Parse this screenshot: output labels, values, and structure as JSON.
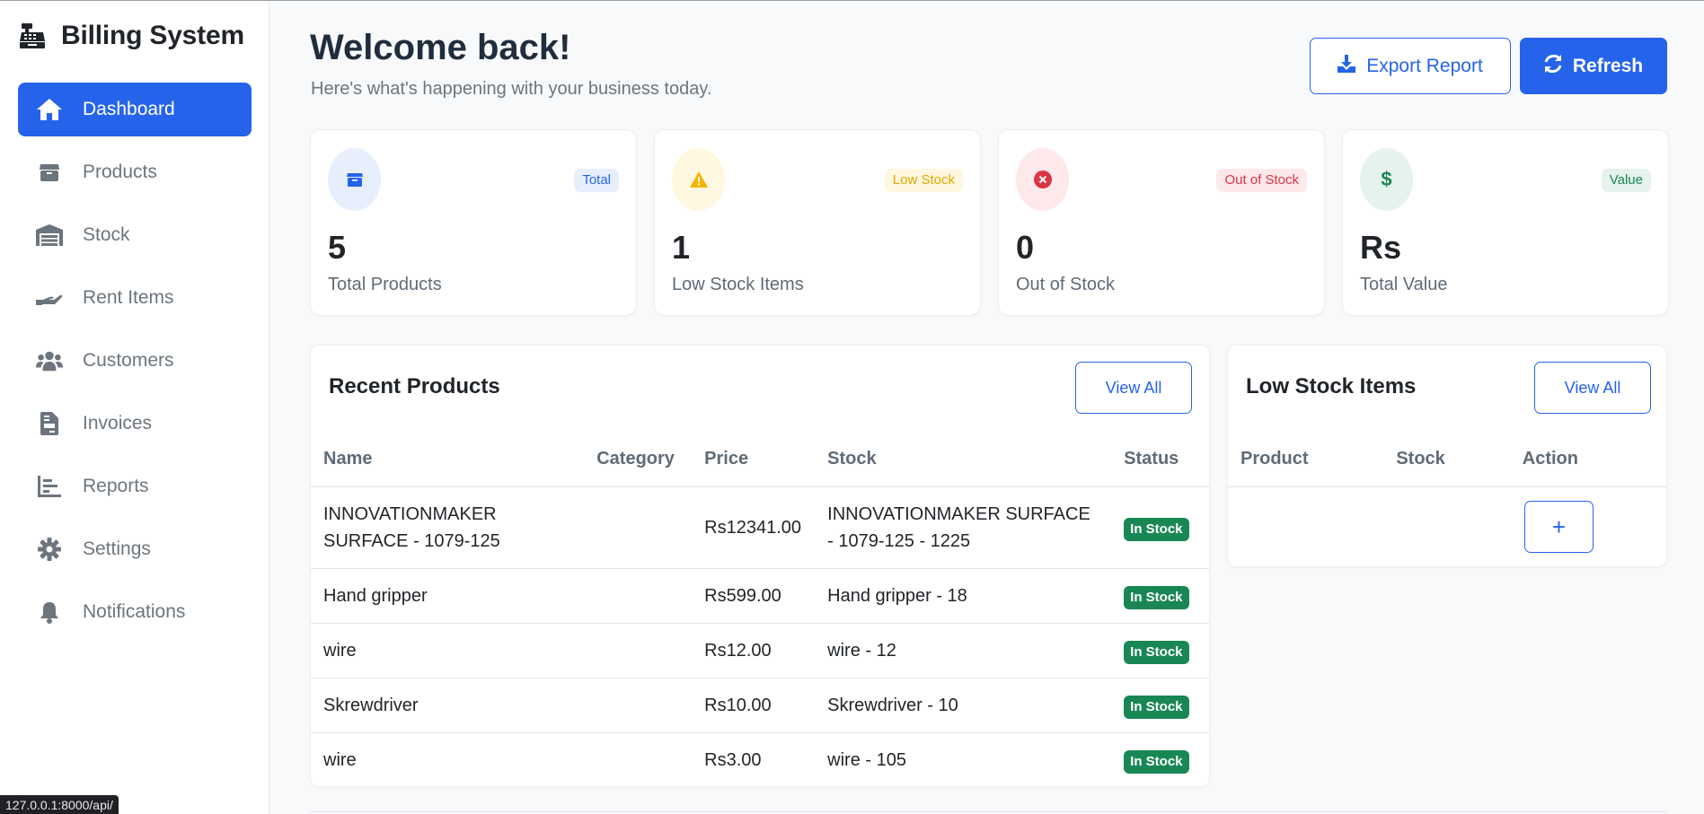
{
  "sidebar": {
    "brand": "Billing System",
    "items": [
      {
        "label": "Dashboard",
        "icon": "home-icon",
        "active": true
      },
      {
        "label": "Products",
        "icon": "box-icon"
      },
      {
        "label": "Stock",
        "icon": "warehouse-icon"
      },
      {
        "label": "Rent Items",
        "icon": "hand-holding-icon"
      },
      {
        "label": "Customers",
        "icon": "users-icon"
      },
      {
        "label": "Invoices",
        "icon": "invoice-icon"
      },
      {
        "label": "Reports",
        "icon": "chart-icon"
      },
      {
        "label": "Settings",
        "icon": "gear-icon"
      },
      {
        "label": "Notifications",
        "icon": "bell-icon"
      }
    ]
  },
  "status_url": "127.0.0.1:8000/api/",
  "header": {
    "title": "Welcome back!",
    "subtitle": "Here's what's happening with your business today.",
    "export_label": "Export Report",
    "refresh_label": "Refresh"
  },
  "stats": [
    {
      "badge": "Total",
      "value": "5",
      "label": "Total Products",
      "icon": "box-icon",
      "color": "#2563eb"
    },
    {
      "badge": "Low Stock",
      "value": "1",
      "label": "Low Stock Items",
      "icon": "warning-icon",
      "color": "#f5b400"
    },
    {
      "badge": "Out of Stock",
      "value": "0",
      "label": "Out of Stock",
      "icon": "x-circle-icon",
      "color": "#dc3545"
    },
    {
      "badge": "Value",
      "value": "Rs",
      "label": "Total Value",
      "icon": "dollar-icon",
      "color": "#198754"
    }
  ],
  "recent": {
    "title": "Recent Products",
    "view_all": "View All",
    "columns": [
      "Name",
      "Category",
      "Price",
      "Stock",
      "Status"
    ],
    "rows": [
      {
        "name": "INNOVATIONMAKER SURFACE - 1079-125",
        "category": "",
        "price": "Rs12341.00",
        "stock": "INNOVATIONMAKER SURFACE - 1079-125 - 1225",
        "status": "In Stock"
      },
      {
        "name": "Hand gripper",
        "category": "",
        "price": "Rs599.00",
        "stock": "Hand gripper - 18",
        "status": "In Stock"
      },
      {
        "name": "wire",
        "category": "",
        "price": "Rs12.00",
        "stock": "wire - 12",
        "status": "In Stock"
      },
      {
        "name": "Skrewdriver",
        "category": "",
        "price": "Rs10.00",
        "stock": "Skrewdriver - 10",
        "status": "In Stock"
      },
      {
        "name": "wire",
        "category": "",
        "price": "Rs3.00",
        "stock": "wire - 105",
        "status": "In Stock"
      }
    ]
  },
  "low_stock": {
    "title": "Low Stock Items",
    "view_all": "View All",
    "columns": [
      "Product",
      "Stock",
      "Action"
    ],
    "add_label": "+"
  }
}
